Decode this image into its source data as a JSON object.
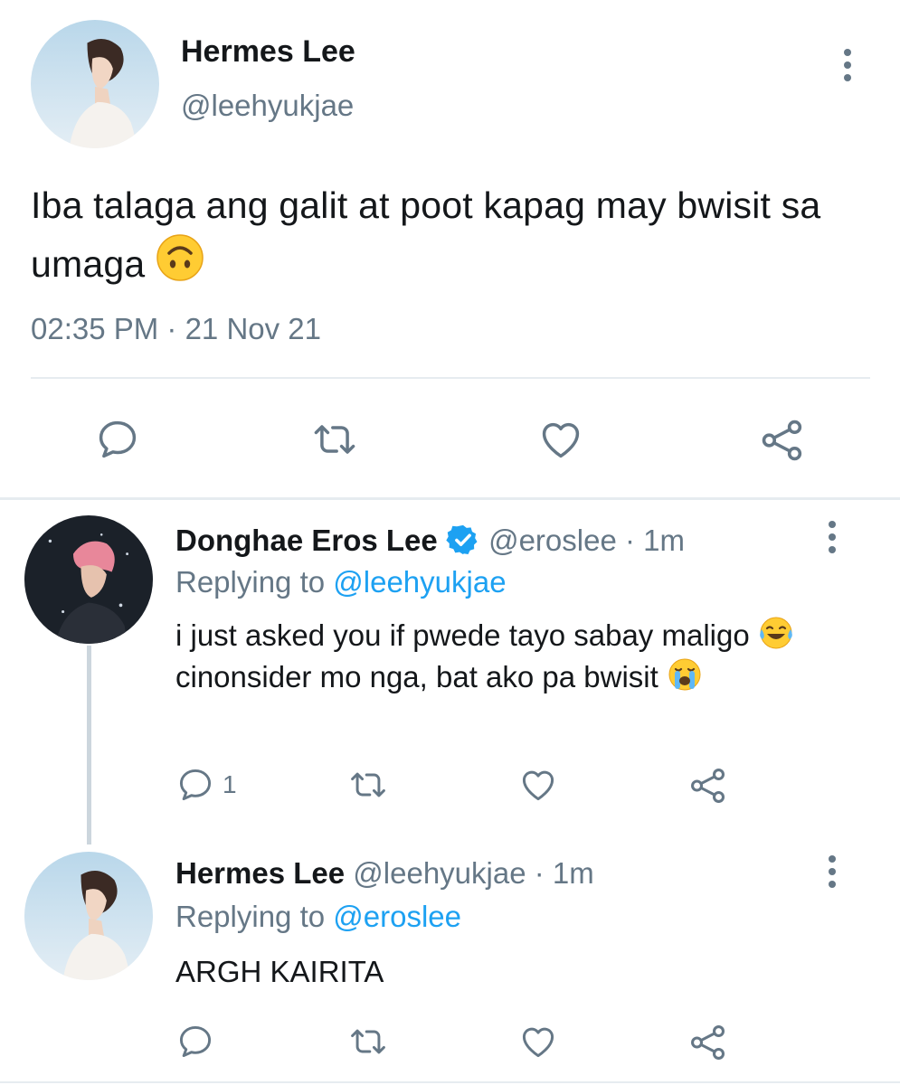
{
  "main_tweet": {
    "author_name": "Hermes Lee",
    "handle": "@leehyukjae",
    "text": "Iba talaga ang galit at poot kapag may bwisit sa umaga",
    "emoji": "upside-down-face",
    "timestamp": "02:35 PM · 21 Nov 21",
    "actions": [
      "reply-icon",
      "retweet-icon",
      "like-icon",
      "share-icon"
    ]
  },
  "replies": [
    {
      "author_name": "Donghae Eros Lee",
      "verified": true,
      "handle": "@eroslee",
      "separator": "·",
      "time": "1m",
      "replying_prefix": "Replying to ",
      "replying_to": "@leehyukjae",
      "text_part1": "i just asked you if pwede tayo sabay maligo",
      "emoji1": "face-with-tears-of-joy",
      "text_part2": "cinonsider mo nga, bat ako pa bwisit",
      "emoji2": "loudly-crying-face",
      "reply_count": "1"
    },
    {
      "author_name": "Hermes Lee",
      "verified": false,
      "handle": "@leehyukjae",
      "separator": "·",
      "time": "1m",
      "replying_prefix": "Replying to ",
      "replying_to": "@eroslee",
      "text": "ARGH KAIRITA",
      "reply_count": ""
    }
  ],
  "colors": {
    "text": "#14171a",
    "secondary": "#657786",
    "link": "#1da1f2",
    "divider": "#e6ecf0",
    "emoji_yellow": "#ffcc33"
  }
}
